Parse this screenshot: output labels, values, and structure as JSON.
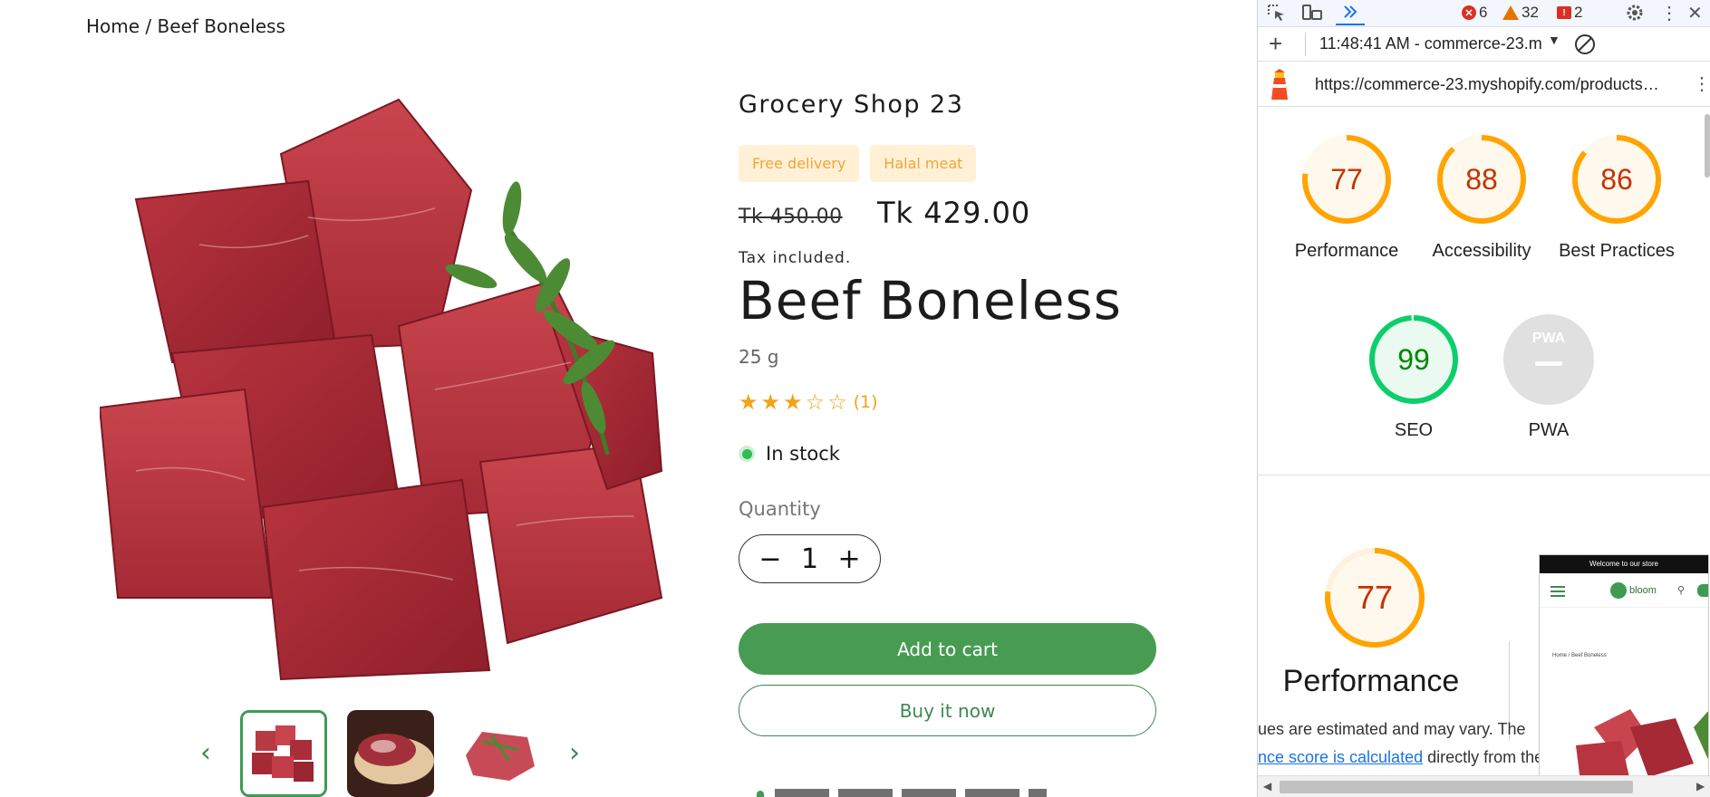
{
  "store": {
    "breadcrumb": "Home / Beef Boneless",
    "vendor": "Grocery Shop 23",
    "badges": [
      "Free delivery",
      "Halal meat"
    ],
    "price_old": "Tk 450.00",
    "price_new": "Tk 429.00",
    "tax_note": "Tax included.",
    "title": "Beef Boneless",
    "weight": "25 g",
    "rating": {
      "value": 3,
      "max": 5,
      "count_label": "(1)"
    },
    "stock": "In stock",
    "quantity": {
      "label": "Quantity",
      "value": "1",
      "minus": "−",
      "plus": "+"
    },
    "add_to_cart": "Add to cart",
    "buy_now": "Buy it now",
    "thumb_prev": "‹",
    "thumb_next": "›"
  },
  "devtools": {
    "counts": {
      "errors": "6",
      "warnings": "32",
      "issues": "2"
    },
    "report_time": "11:48:41 AM - commerce-23.m",
    "url": "https://commerce-23.myshopify.com/products…",
    "categories": [
      {
        "key": "performance",
        "score": "77",
        "label": "Performance",
        "color": "#ffa400",
        "fill": "#fff8ec",
        "text": "#c33300",
        "pct": 0.77
      },
      {
        "key": "accessibility",
        "score": "88",
        "label": "Accessibility",
        "color": "#ffa400",
        "fill": "#fff8ec",
        "text": "#c33300",
        "pct": 0.88
      },
      {
        "key": "best-practices",
        "score": "86",
        "label": "Best Practices",
        "color": "#ffa400",
        "fill": "#fff8ec",
        "text": "#c33300",
        "pct": 0.86
      },
      {
        "key": "seo",
        "score": "99",
        "label": "SEO",
        "color": "#0cce6b",
        "fill": "#eafaf1",
        "text": "#008800",
        "pct": 0.99
      }
    ],
    "pwa": {
      "label": "PWA",
      "badge": "PWA"
    },
    "perf_section": {
      "score": "77",
      "title": "Performance",
      "desc_line1": "ues are estimated and may vary. The",
      "desc_link": "nce score is calculated",
      "desc_rest": " directly from the"
    },
    "preview": {
      "banner": "Welcome to our store",
      "brand": "bloom",
      "breadcrumb": "Home / Beef Boneless"
    }
  },
  "colors": {
    "brand_green": "#479c52",
    "badge_bg": "#fff0d6",
    "badge_text": "#f0a53a",
    "star": "#f2a316"
  }
}
